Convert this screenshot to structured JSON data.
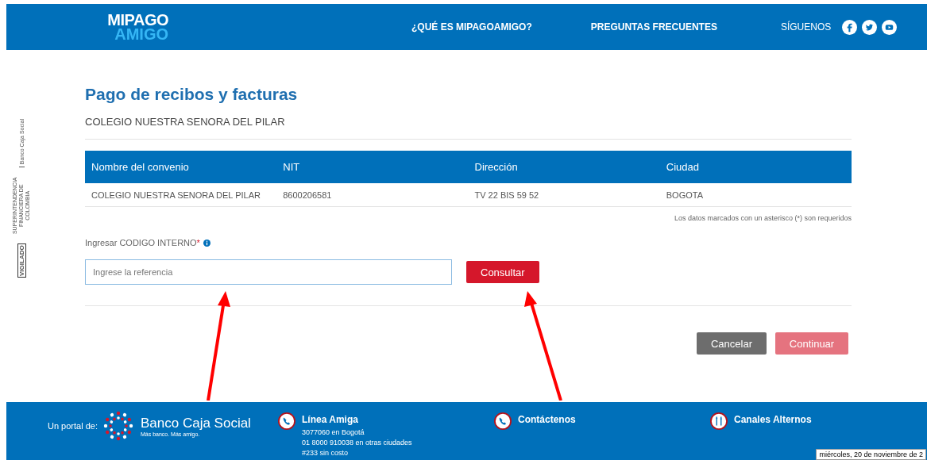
{
  "header": {
    "logo_top": "MIPAGO",
    "logo_bottom": "AMIGO",
    "nav": [
      {
        "label": "¿QUÉ ES MIPAGOAMIGO?"
      },
      {
        "label": "PREGUNTAS FRECUENTES"
      }
    ],
    "follow_label": "SÍGUENOS"
  },
  "side_seal": {
    "badge": "VIGILADO",
    "authority": "SUPERINTENDENCIA FINANCIERA DE COLOMBIA",
    "entity": "Banco Caja Social"
  },
  "page": {
    "title": "Pago de recibos y facturas",
    "subtitle": "COLEGIO NUESTRA SENORA DEL PILAR"
  },
  "table": {
    "columns": [
      "Nombre del convenio",
      "NIT",
      "Dirección",
      "Ciudad"
    ],
    "rows": [
      [
        "COLEGIO NUESTRA SENORA DEL PILAR",
        "8600206581",
        "TV 22 BIS 59 52",
        "BOGOTA"
      ]
    ]
  },
  "required_note": "Los datos marcados con un asterisco (*) son requeridos",
  "field": {
    "label": "Ingresar CODIGO INTERNO",
    "required_mark": "*",
    "placeholder": "Ingrese la referencia"
  },
  "query_button": "Consultar",
  "actions": [
    {
      "label": "Cancelar",
      "kind": "secondary",
      "disabled": false
    },
    {
      "label": "Continuar",
      "kind": "primary",
      "disabled": true
    }
  ],
  "footer": {
    "portal_label": "Un portal de:",
    "bank_name": "Banco Caja Social",
    "bank_slogan": "Más banco. Más amigo.",
    "sections": [
      {
        "title": "Línea Amiga",
        "lines": [
          "3077060 en Bogotá",
          "01 8000 910038 en otras ciudades",
          "#233 sin costo"
        ]
      },
      {
        "title": "Contáctenos"
      },
      {
        "title": "Canales Alternos"
      }
    ]
  },
  "tooltip": "miércoles, 20 de noviembre de 2"
}
